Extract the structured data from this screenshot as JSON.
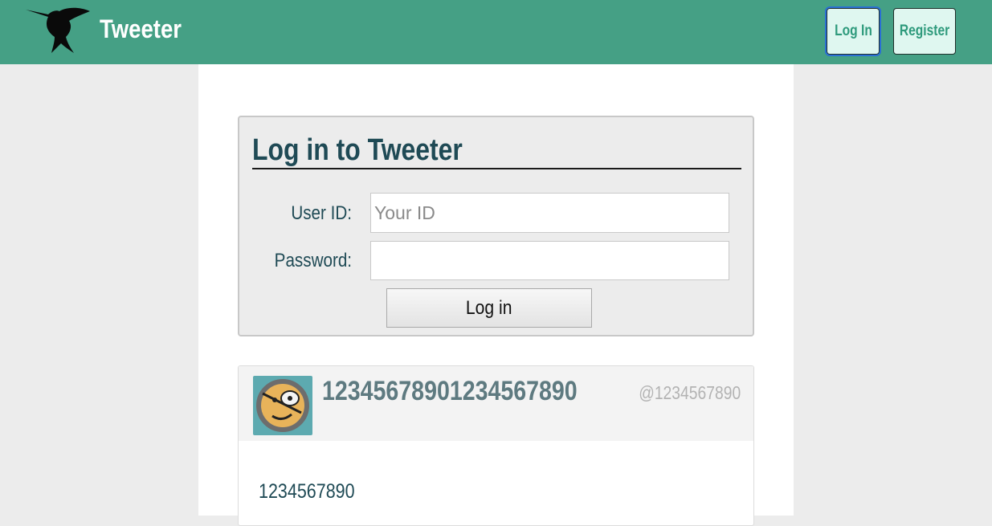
{
  "header": {
    "brand": "Tweeter",
    "logo_icon": "hummingbird-icon",
    "nav": {
      "login_label": "Log In",
      "register_label": "Register"
    },
    "colors": {
      "bar": "#45a085",
      "button_bg": "#dff7f0",
      "button_text": "#2e9a7c"
    }
  },
  "login_form": {
    "title": "Log in to Tweeter",
    "user_id_label": "User ID:",
    "user_id_placeholder": "Your ID",
    "user_id_value": "",
    "password_label": "Password:",
    "password_value": "",
    "submit_label": "Log in"
  },
  "tweet": {
    "avatar_icon": "pirate-smiley-avatar-icon",
    "display_name": "12345678901234567890",
    "handle": "@1234567890",
    "text": "1234567890"
  }
}
